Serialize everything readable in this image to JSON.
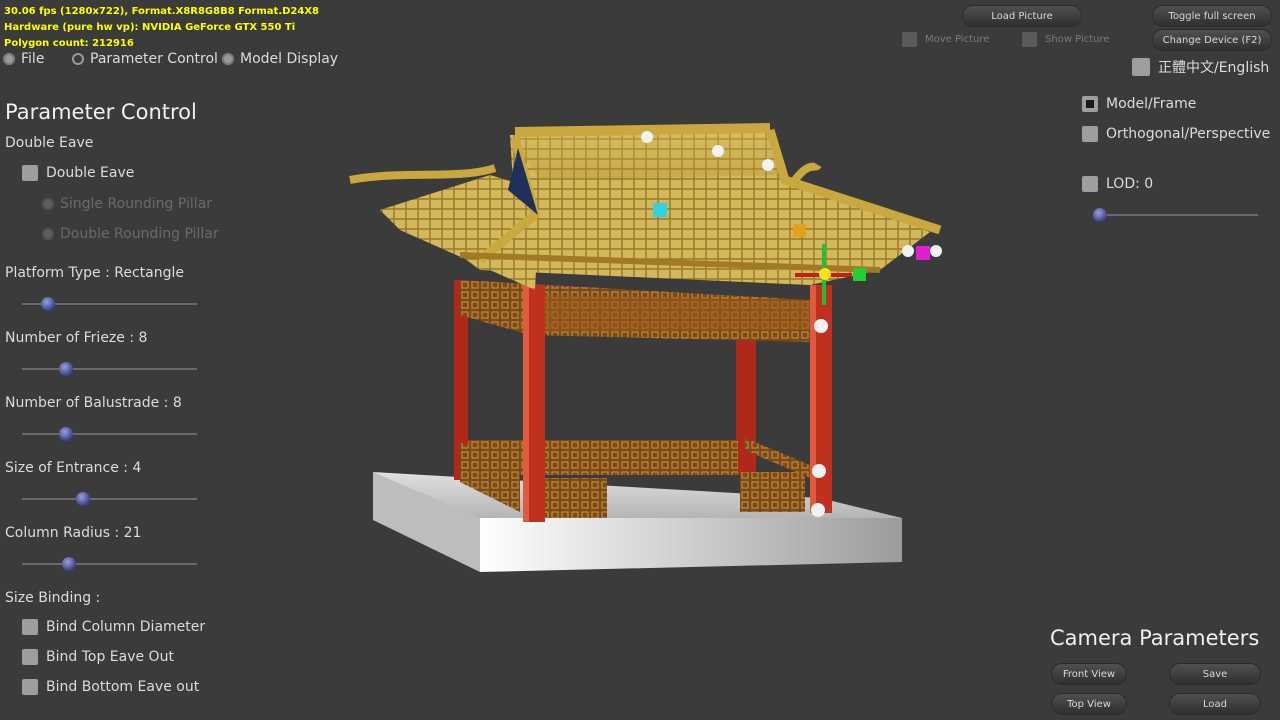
{
  "stats": {
    "line1": "30.06 fps (1280x722), Format.X8R8G8B8 Format.D24X8",
    "line2": "Hardware (pure hw vp): NVIDIA GeForce GTX 550 Ti",
    "line3": "Polygon count: 212916"
  },
  "top_menu": {
    "file": "File",
    "parameter_control": "Parameter Control",
    "model_display": "Model Display"
  },
  "top_right": {
    "load_picture": "Load Picture",
    "toggle_full_screen": "Toggle full screen",
    "move_picture": "Move Picture",
    "show_picture": "Show Picture",
    "change_device": "Change Device (F2)",
    "language": "正體中文/English"
  },
  "display_options": {
    "model_frame": "Model/Frame",
    "ortho_persp": "Orthogonal/Perspective",
    "lod": "LOD: 0",
    "lod_level": 0
  },
  "parameter_control": {
    "title": "Parameter Control",
    "double_eave_section": "Double Eave",
    "double_eave_checkbox": "Double Eave",
    "single_rounding": "Single Rounding Pillar",
    "double_rounding": "Double Rounding Pillar",
    "platform_type": "Platform Type : Rectangle",
    "platform_level": 0.15,
    "frieze": "Number of Frieze : 8",
    "frieze_level": 0.25,
    "balustrade": "Number of Balustrade : 8",
    "balustrade_level": 0.25,
    "entrance": "Size of Entrance : 4",
    "entrance_level": 0.35,
    "column_radius": "Column Radius : 21",
    "column_radius_level": 0.27,
    "size_binding": "Size Binding :",
    "bind_column": "Bind Column Diameter",
    "bind_top_eave": "Bind Top Eave Out",
    "bind_bottom_eave": "Bind Bottom Eave out"
  },
  "camera": {
    "title": "Camera Parameters",
    "front_view": "Front View",
    "save": "Save",
    "top_view": "Top View",
    "load": "Load"
  }
}
